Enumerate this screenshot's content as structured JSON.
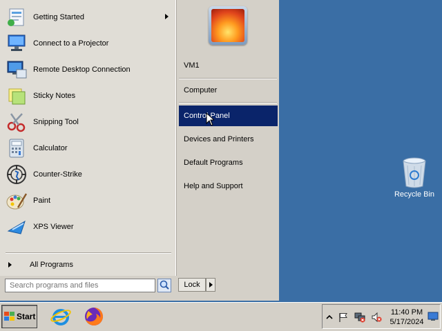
{
  "desktop": {
    "background": "#3a6ea5",
    "icons": [
      {
        "label": "Recycle Bin",
        "icon": "recycle-bin-icon"
      }
    ]
  },
  "start_menu": {
    "programs": [
      {
        "label": "Getting Started",
        "icon": "getting-started-icon",
        "has_submenu": true
      },
      {
        "label": "Connect to a Projector",
        "icon": "projector-icon"
      },
      {
        "label": "Remote Desktop Connection",
        "icon": "remote-desktop-icon"
      },
      {
        "label": "Sticky Notes",
        "icon": "sticky-notes-icon"
      },
      {
        "label": "Snipping Tool",
        "icon": "snipping-tool-icon"
      },
      {
        "label": "Calculator",
        "icon": "calculator-icon"
      },
      {
        "label": "Counter-Strike",
        "icon": "counter-strike-icon"
      },
      {
        "label": "Paint",
        "icon": "paint-icon"
      },
      {
        "label": "XPS Viewer",
        "icon": "xps-viewer-icon"
      }
    ],
    "all_programs_label": "All Programs",
    "search_placeholder": "Search programs and files",
    "lock_label": "Lock",
    "user_name": "VM1",
    "places": [
      {
        "label": "Computer",
        "selected": false
      },
      {
        "label": "Control Panel",
        "selected": true
      },
      {
        "label": "Devices and Printers",
        "selected": false
      },
      {
        "label": "Default Programs",
        "selected": false
      },
      {
        "label": "Help and Support",
        "selected": false
      }
    ],
    "selection_color": "#0a246a"
  },
  "taskbar": {
    "start_label": "Start",
    "pinned": [
      {
        "name": "Internet Explorer",
        "icon": "internet-explorer-icon"
      },
      {
        "name": "Firefox",
        "icon": "firefox-icon"
      }
    ],
    "tray_icons": [
      "show-hidden-icons-chevron",
      "action-center-flag-icon",
      "network-icon",
      "volume-muted-icon"
    ],
    "clock": {
      "time": "11:40 PM",
      "date": "5/17/2024"
    }
  }
}
